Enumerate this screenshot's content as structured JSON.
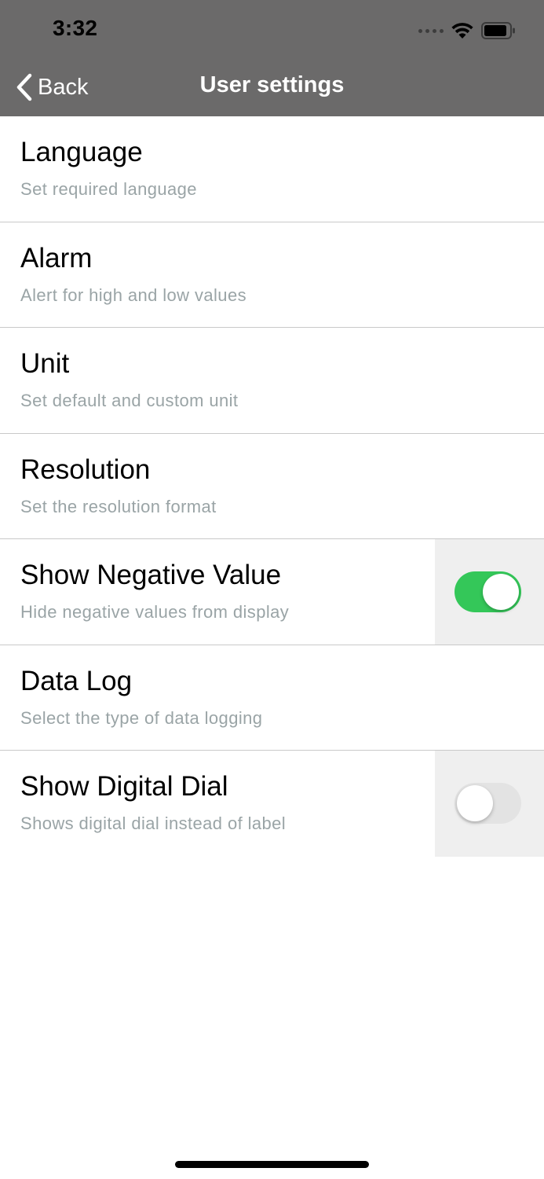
{
  "status_bar": {
    "time": "3:32",
    "icons": [
      "signal-dots-icon",
      "wifi-icon",
      "battery-icon"
    ]
  },
  "nav": {
    "back_label": "Back",
    "title": "User settings"
  },
  "colors": {
    "header_bg": "#6b6a6a",
    "toggle_on": "#34c759",
    "subtitle": "#9aa4a6"
  },
  "settings": [
    {
      "title": "Language",
      "subtitle": "Set required language"
    },
    {
      "title": "Alarm",
      "subtitle": "Alert for high and low values"
    },
    {
      "title": "Unit",
      "subtitle": "Set default and custom unit"
    },
    {
      "title": "Resolution",
      "subtitle": "Set the resolution format"
    },
    {
      "title": "Show Negative Value",
      "subtitle": "Hide negative values from display",
      "toggle": true
    },
    {
      "title": "Data Log",
      "subtitle": "Select the type of data logging"
    },
    {
      "title": "Show Digital Dial",
      "subtitle": "Shows digital dial instead of label",
      "toggle": false
    }
  ]
}
